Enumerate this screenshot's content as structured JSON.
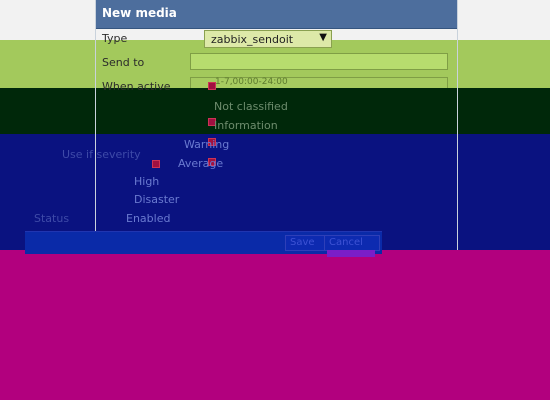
{
  "dialog": {
    "title": "New media",
    "type_label": "Type",
    "type_value": "zabbix_sendoit",
    "send_to_label": "Send to",
    "when_active_label": "When active",
    "when_active_value": "1-7,00:00-24:00",
    "use_if_severity_label": "Use if severity",
    "severities": [
      {
        "label": "Not classified",
        "checked": true
      },
      {
        "label": "Information",
        "checked": true
      },
      {
        "label": "Warning",
        "checked": true
      },
      {
        "label": "Average",
        "checked": true
      },
      {
        "label": "High",
        "checked": true
      },
      {
        "label": "Disaster",
        "checked": true
      }
    ],
    "status_label": "Status",
    "status_value": "Enabled",
    "save_label": "Save",
    "cancel_label": "Cancel"
  },
  "colors": {
    "titlebar": "#4d6e9d",
    "green_band": "#a3c95c",
    "dark_band": "#00280a",
    "blue_band": "#0a1280",
    "magenta_band": "#b2007e"
  },
  "icons": [
    "chevron-down-icon",
    "checkbox-icon"
  ]
}
